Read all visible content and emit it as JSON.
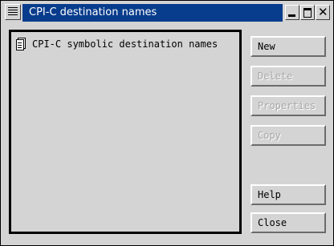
{
  "window": {
    "title": "CPI-C destination names",
    "title_bar_color": "#083c8c",
    "controls": {
      "system_menu_icon": "system-menu-icon",
      "minimize_icon": "minimize-icon",
      "maximize_icon": "maximize-icon",
      "close_icon": "close-icon",
      "close_glyph": "✕"
    }
  },
  "list": {
    "items": [
      {
        "label": "CPI-C symbolic destination names",
        "icon": "document-icon"
      }
    ]
  },
  "buttons": {
    "new": {
      "label": "New",
      "enabled": true
    },
    "delete": {
      "label": "Delete",
      "enabled": false
    },
    "properties": {
      "label": "Properties",
      "enabled": false
    },
    "copy": {
      "label": "Copy",
      "enabled": false
    },
    "help": {
      "label": "Help",
      "enabled": true
    },
    "close": {
      "label": "Close",
      "enabled": true
    }
  }
}
